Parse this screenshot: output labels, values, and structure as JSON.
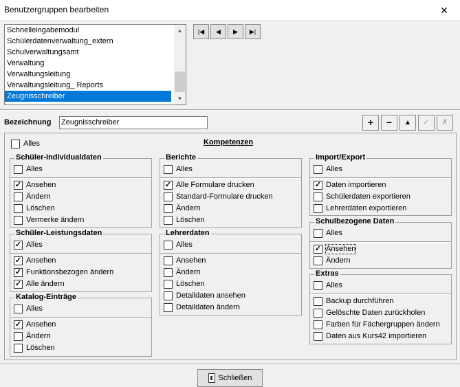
{
  "window": {
    "title": "Benutzergruppen bearbeiten",
    "close_glyph": "✕"
  },
  "groups_list": {
    "items": [
      "Schnelleingabemodul",
      "Schülerdatenverwaltung_extern",
      "Schulverwaltungsamt",
      "Verwaltung",
      "Verwaltungsleitung",
      "Verwaltungsleitung_ Reports",
      "Zeugnisschreiber"
    ],
    "selected": "Zeugnisschreiber"
  },
  "nav": {
    "first": "|◀",
    "prev": "◀",
    "next": "▶",
    "last": "▶|"
  },
  "bezeichnung": {
    "label": "Bezeichnung",
    "value": "Zeugnisschreiber"
  },
  "toolbar": {
    "add": "+",
    "remove": "−",
    "up": "▲",
    "check": "✓",
    "cancel": "✗"
  },
  "kompetenzen": {
    "heading": "Kompetenzen",
    "alles_label": "Alles",
    "schueler_individualdaten": {
      "title": "Schüler-Individualdaten",
      "alles": "Alles",
      "ansehen": "Ansehen",
      "aendern": "Ändern",
      "loeschen": "Löschen",
      "vermerke": "Vermerke ändern"
    },
    "schueler_leistungsdaten": {
      "title": "Schüler-Leistungsdaten",
      "alles": "Alles",
      "ansehen": "Ansehen",
      "funktionsbezogen": "Funktionsbezogen ändern",
      "alle_aendern": "Alle ändern"
    },
    "katalog": {
      "title": "Katalog-Einträge",
      "alles": "Alles",
      "ansehen": "Ansehen",
      "aendern": "Ändern",
      "loeschen": "Löschen"
    },
    "berichte": {
      "title": "Berichte",
      "alles": "Alles",
      "alle_formulare": "Alle Formulare drucken",
      "standard_formulare": "Standard-Formulare drucken",
      "aendern": "Ändern",
      "loeschen": "Löschen"
    },
    "lehrerdaten": {
      "title": "Lehrerdaten",
      "alles": "Alles",
      "ansehen": "Ansehen",
      "aendern": "Ändern",
      "loeschen": "Löschen",
      "detail_ansehen": "Detaildaten ansehen",
      "detail_aendern": "Detaildaten ändern"
    },
    "import_export": {
      "title": "Import/Export",
      "alles": "Alles",
      "daten_import": "Daten importieren",
      "schueler_export": "Schülerdaten exportieren",
      "lehrer_export": "Lehrerdaten exportieren"
    },
    "schulbezogen": {
      "title": "Schulbezogene Daten",
      "alles": "Alles",
      "ansehen": "Ansehen",
      "aendern": "Ändern"
    },
    "extras": {
      "title": "Extras",
      "alles": "Alles",
      "backup": "Backup durchführen",
      "geloeschte": "Gelöschte Daten zurückholen",
      "farben": "Farben für Fächergruppen ändern",
      "kurs42": "Daten aus Kurs42 importieren"
    }
  },
  "close_button": {
    "label": "Schließen"
  }
}
